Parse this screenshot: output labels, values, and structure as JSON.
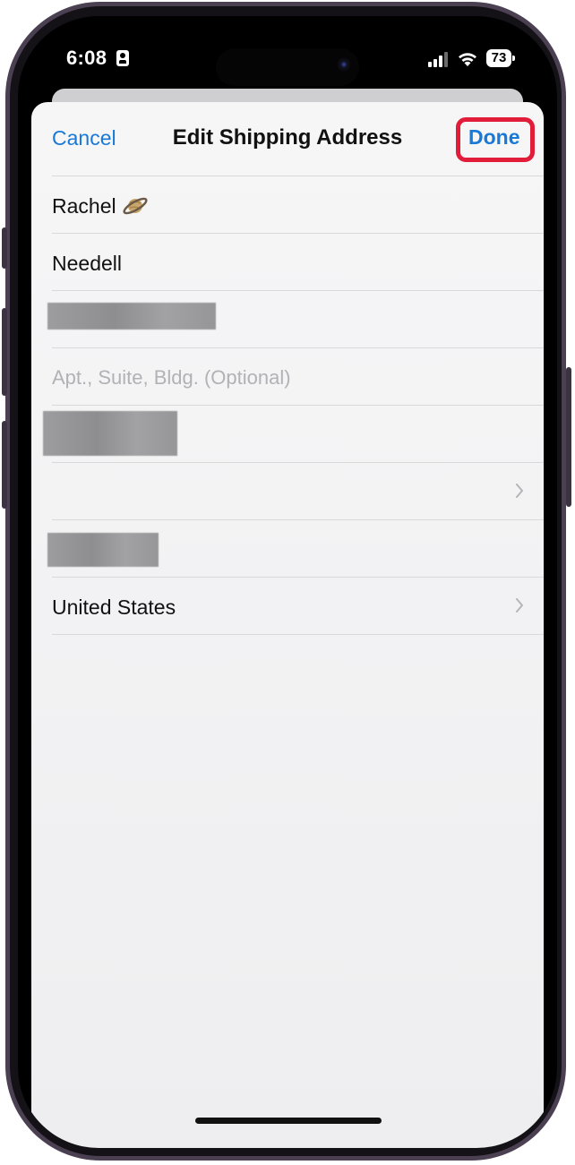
{
  "status_bar": {
    "time": "6:08",
    "battery": "73",
    "icons": [
      "contact-card-icon",
      "signal-icon",
      "wifi-icon",
      "battery-icon"
    ]
  },
  "nav": {
    "cancel_label": "Cancel",
    "title": "Edit Shipping Address",
    "done_label": "Done",
    "done_highlight_color": "#e11d3a",
    "accent_color": "#1979d6"
  },
  "form": {
    "first_name": "Rachel",
    "first_name_emoji": "saturn-icon",
    "last_name": "Needell",
    "street": "",
    "apt_placeholder": "Apt., Suite, Bldg. (Optional)",
    "city": "",
    "state": "",
    "zip": "",
    "country": "United States"
  }
}
